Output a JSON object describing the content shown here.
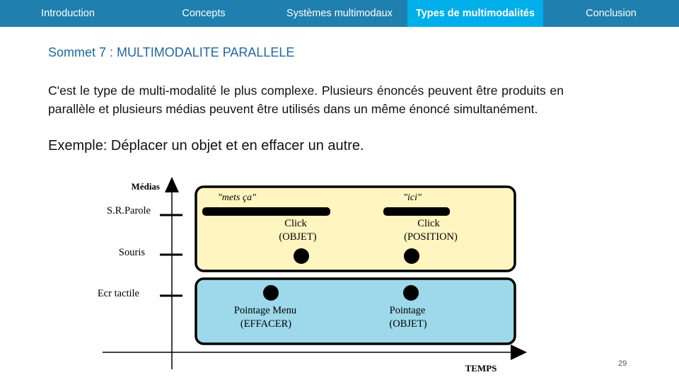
{
  "nav": {
    "items": [
      {
        "label": "Introduction",
        "active": false
      },
      {
        "label": "Concepts",
        "active": false
      },
      {
        "label": "Systèmes multimodaux",
        "active": false
      },
      {
        "label": "Types de multimodalités",
        "active": true
      },
      {
        "label": "Conclusion",
        "active": false
      }
    ],
    "colors": {
      "bar": "#1f7fae",
      "active": "#00aeea",
      "text": "#ffffff"
    }
  },
  "slide": {
    "title": "Sommet 7 : MULTIMODALITE PARALLELE",
    "paragraph": "C'est le type de multi-modalité le plus complexe. Plusieurs énoncés peuvent être produits en parallèle et plusieurs médias peuvent être utilisés dans un même énoncé simultanément.",
    "example": "Exemple: Déplacer un objet et en effacer un autre.",
    "page_number": "29"
  },
  "diagram": {
    "y_axis_label": "Médias",
    "x_axis_label": "TEMPS",
    "media": [
      "S.R.Parole",
      "Souris",
      "Ecr tactile"
    ],
    "utterance1": {
      "color": "#fff5c0",
      "speech": [
        {
          "label": "\"mets ça\""
        },
        {
          "label": "\"ici\""
        }
      ],
      "clicks": [
        {
          "line1": "Click",
          "line2": "(OBJET)"
        },
        {
          "line1": "Click",
          "line2": "(POSITION)"
        }
      ]
    },
    "utterance2": {
      "color": "#9dd9ea",
      "pointing": [
        {
          "line1": "Pointage Menu",
          "line2": "(EFFACER)"
        },
        {
          "line1": "Pointage",
          "line2": "(OBJET)"
        }
      ]
    }
  }
}
